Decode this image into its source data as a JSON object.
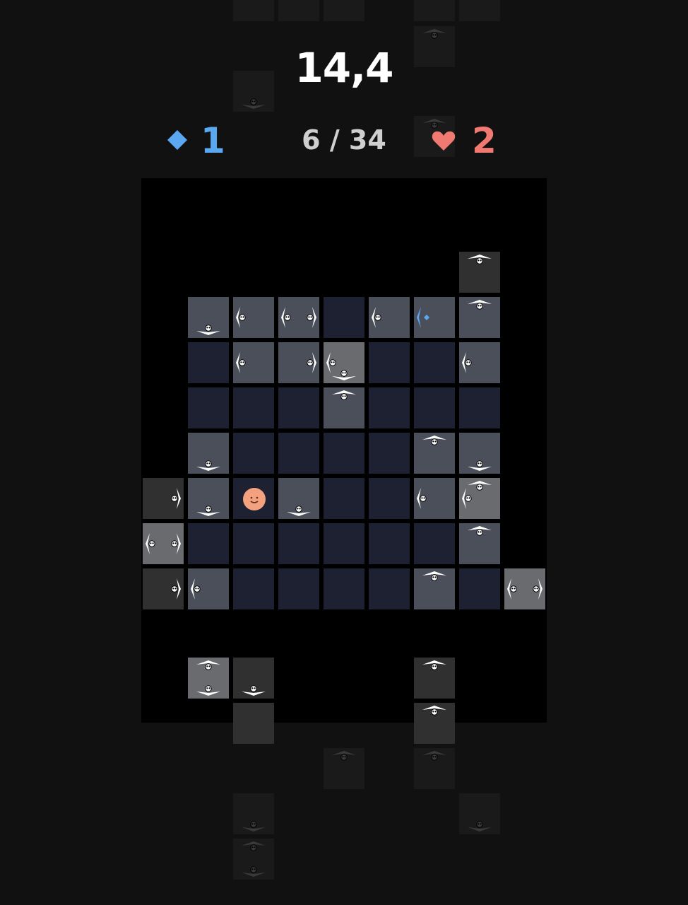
{
  "hud": {
    "timer": "14,4",
    "gems": "1",
    "moves": "6 / 34",
    "lives": "2",
    "colors": {
      "gem": "#5aa8f0",
      "heart": "#f07a72",
      "player": "#f3a17e"
    }
  },
  "legend": {
    "arrow_icon": "skull-spike-icon",
    "gem_icon": "diamond-icon",
    "heart_icon": "heart-icon"
  }
}
